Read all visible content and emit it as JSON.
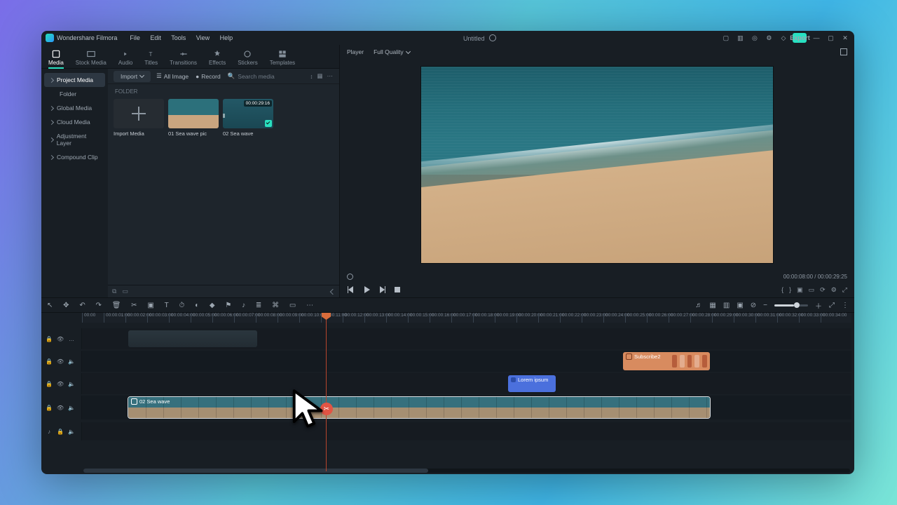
{
  "app": {
    "brand": "Wondershare Filmora",
    "title": "Untitled"
  },
  "menus": [
    "File",
    "Edit",
    "Tools",
    "View",
    "Help"
  ],
  "export_label": "Export",
  "top_tabs": [
    {
      "label": "Media"
    },
    {
      "label": "Stock Media"
    },
    {
      "label": "Audio"
    },
    {
      "label": "Titles"
    },
    {
      "label": "Transitions"
    },
    {
      "label": "Effects"
    },
    {
      "label": "Stickers"
    },
    {
      "label": "Templates"
    }
  ],
  "media_sidebar": {
    "project_media": "Project Media",
    "folder": "Folder",
    "items": [
      "Global Media",
      "Cloud Media",
      "Adjustment Layer",
      "Compound Clip"
    ]
  },
  "import_bar": {
    "import": "Import",
    "all_image": "All Image",
    "record": "Record",
    "search_placeholder": "Search media"
  },
  "folder_label": "FOLDER",
  "thumbs": {
    "import": "Import Media",
    "a_name": "01 Sea wave pic",
    "b_name": "02 Sea wave",
    "b_dur": "00:00:29:16"
  },
  "preview": {
    "player": "Player",
    "quality": "Full Quality",
    "time_cur": "00:00:08:00",
    "time_dur": "00:00:29:25"
  },
  "ruler": [
    "00:00",
    "00:00:01:00",
    "00:00:02:00",
    "00:00:03:00",
    "00:00:04:00",
    "00:00:05:00",
    "00:00:06:00",
    "00:00:07:00",
    "00:00:08:00",
    "00:00:09:00",
    "00:00:10:00",
    "00:00:11:00",
    "00:00:12:00",
    "00:00:13:00",
    "00:00:14:00",
    "00:00:15:00",
    "00:00:16:00",
    "00:00:17:00",
    "00:00:18:00",
    "00:00:19:00",
    "00:00:20:00",
    "00:00:21:00",
    "00:00:22:00",
    "00:00:23:00",
    "00:00:24:00",
    "00:00:25:00",
    "00:00:26:00",
    "00:00:27:00",
    "00:00:28:00",
    "00:00:29:00",
    "00:00:30:00",
    "00:00:31:00",
    "00:00:32:00",
    "00:00:33:00",
    "00:00:34:00"
  ],
  "clips": {
    "subscribe": "Subscribe2",
    "lorem": "Lorem ipsum",
    "main": "02 Sea wave"
  }
}
